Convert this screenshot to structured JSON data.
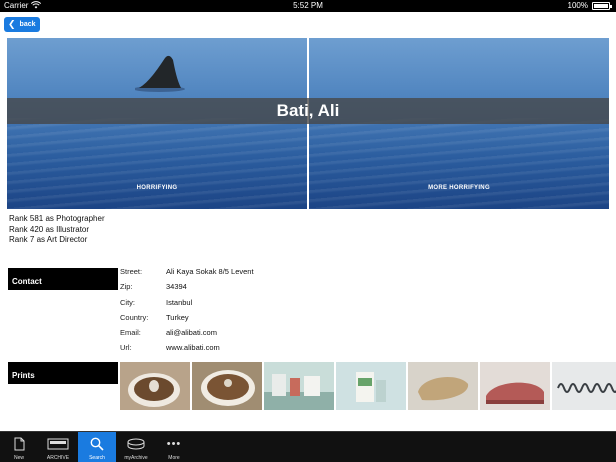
{
  "status_bar": {
    "carrier": "Carrier",
    "time": "5:52 PM",
    "battery": "100%"
  },
  "header": {
    "back_label": "back"
  },
  "hero": {
    "name": "Bati, Ali",
    "panels": [
      {
        "caption": "HORRIFYING"
      },
      {
        "caption": "MORE HORRIFYING"
      }
    ]
  },
  "ranks": [
    "Rank 581 as Photographer",
    "Rank 420 as Illustrator",
    "Rank 7 as Art Director"
  ],
  "contact": {
    "label": "Contact",
    "rows": [
      {
        "key": "Street:",
        "value": "Ali Kaya Sokak 8/5 Levent"
      },
      {
        "key": "Zip:",
        "value": "34394"
      },
      {
        "key": "City:",
        "value": "Istanbul"
      },
      {
        "key": "Country:",
        "value": "Turkey"
      },
      {
        "key": "Email:",
        "value": "ali@alibati.com"
      },
      {
        "key": "Url:",
        "value": "www.alibati.com"
      }
    ]
  },
  "prints": {
    "label": "Prints",
    "thumbnails": [
      "cup-print-1",
      "cup-print-2",
      "lab-print",
      "box-print",
      "pillow-print",
      "cushion-print",
      "coil-print"
    ]
  },
  "tab_bar": {
    "active": "Search",
    "tabs": [
      {
        "label": "New",
        "icon": "document-icon"
      },
      {
        "label": "ARCHIVE",
        "icon": "archive-icon"
      },
      {
        "label": "Search",
        "icon": "search-icon"
      },
      {
        "label": "myArchive",
        "icon": "stack-icon"
      },
      {
        "label": "More",
        "icon": "more-icon"
      }
    ]
  },
  "colors": {
    "accent": "#1a7be0",
    "band": "#464646",
    "section_label_bg": "#000000",
    "tab_bar_bg": "#111111"
  }
}
